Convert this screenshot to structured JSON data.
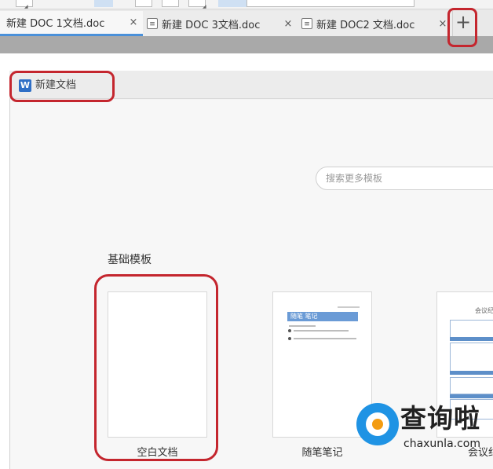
{
  "tabs": [
    {
      "label": "新建 DOC 1文档.doc",
      "close": "×",
      "icon": "doc-icon",
      "active": true
    },
    {
      "label": "新建 DOC 3文档.doc",
      "close": "×",
      "icon": "doc-icon",
      "active": false
    },
    {
      "label": "新建 DOC2 文档.doc",
      "close": "×",
      "icon": "doc-icon",
      "active": false
    }
  ],
  "new_tab_label": "+",
  "window": {
    "logo": "W",
    "title": "新建文档"
  },
  "search": {
    "placeholder": "搜索更多模板"
  },
  "section_heading": "基础模板",
  "templates": [
    {
      "caption": "空白文档"
    },
    {
      "caption": "随笔笔记",
      "banner": "随笔 笔记"
    },
    {
      "caption": "会议纪",
      "header": "会议纪"
    }
  ],
  "watermark": {
    "text": "查询啦",
    "domain": "chaxunla.com"
  },
  "colors": {
    "accent": "#4a90d9",
    "highlight": "#c4262e",
    "logo": "#2f6fc6"
  }
}
